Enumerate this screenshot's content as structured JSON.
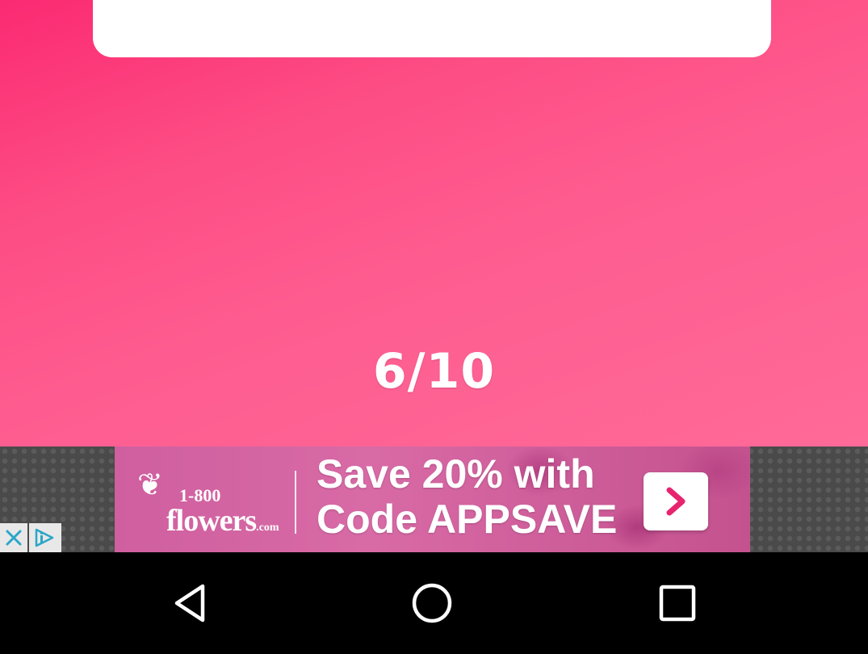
{
  "card": {
    "partial_text": ""
  },
  "quiz": {
    "progress_text": "6/10",
    "current": 6,
    "total": 10
  },
  "ad": {
    "brand_number": "1-800",
    "brand_name": "flowers",
    "brand_suffix": ".com",
    "headline_line1": "Save 20% with",
    "headline_line2": "Code APPSAVE",
    "cta_icon": "chevron-right-icon",
    "close_icon": "close-icon",
    "info_icon": "adchoices-icon"
  },
  "nav": {
    "back_icon": "back-triangle-icon",
    "home_icon": "home-circle-icon",
    "recents_icon": "recents-square-icon"
  },
  "colors": {
    "background_start": "#fb2a72",
    "background_end": "#ff6a98",
    "card": "#ffffff",
    "nav_bar": "#000000"
  }
}
